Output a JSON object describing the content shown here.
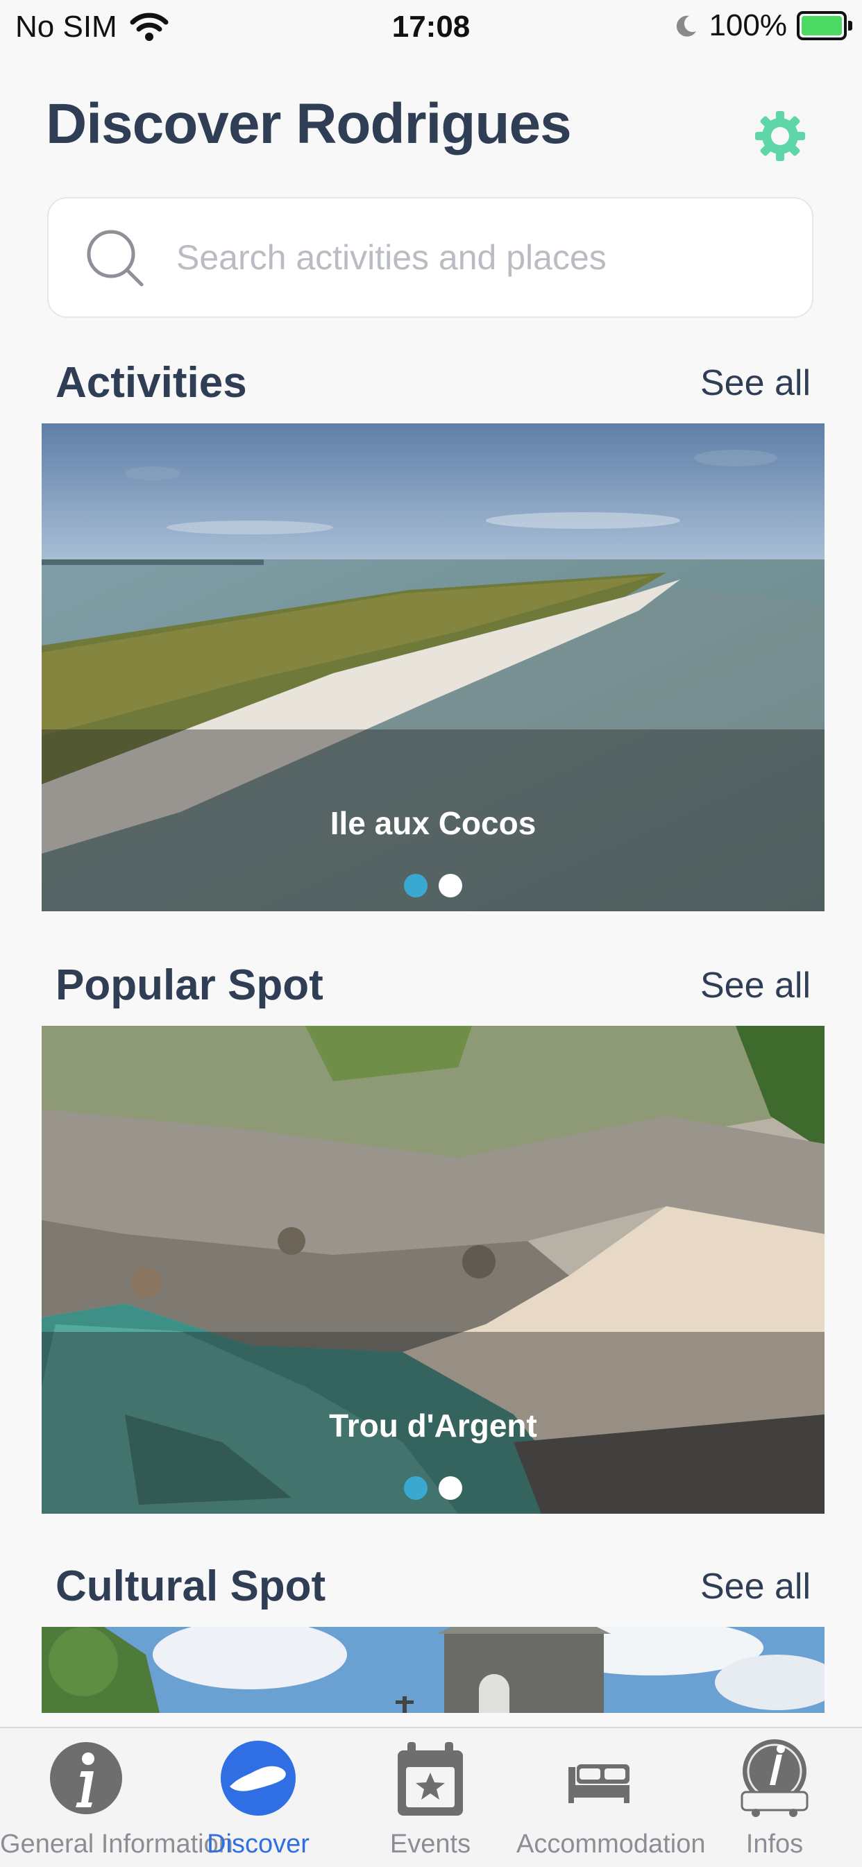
{
  "status_bar": {
    "carrier": "No SIM",
    "time": "17:08",
    "battery": "100%"
  },
  "header": {
    "title": "Discover Rodrigues",
    "settings_icon": "gear-icon"
  },
  "search": {
    "placeholder": "Search activities and places",
    "icon": "search-icon"
  },
  "sections": [
    {
      "title": "Activities",
      "see_all": "See all",
      "card": {
        "caption": "Ile aux Cocos",
        "active_dot": 0,
        "dot_count": 2
      }
    },
    {
      "title": "Popular Spot",
      "see_all": "See all",
      "card": {
        "caption": "Trou d'Argent",
        "active_dot": 0,
        "dot_count": 2
      }
    },
    {
      "title": "Cultural Spot",
      "see_all": "See all"
    }
  ],
  "tabs": [
    {
      "label": "General Information",
      "icon": "info-icon"
    },
    {
      "label": "Discover",
      "icon": "island-icon",
      "active": true
    },
    {
      "label": "Events",
      "icon": "calendar-star-icon"
    },
    {
      "label": "Accommodation",
      "icon": "bed-icon"
    },
    {
      "label": "Infos",
      "icon": "bus-info-icon"
    }
  ],
  "colors": {
    "accent": "#2f6fe3",
    "gear": "#5ed6a8",
    "dot_active": "#3aa9d1",
    "title": "#2f3e55"
  }
}
